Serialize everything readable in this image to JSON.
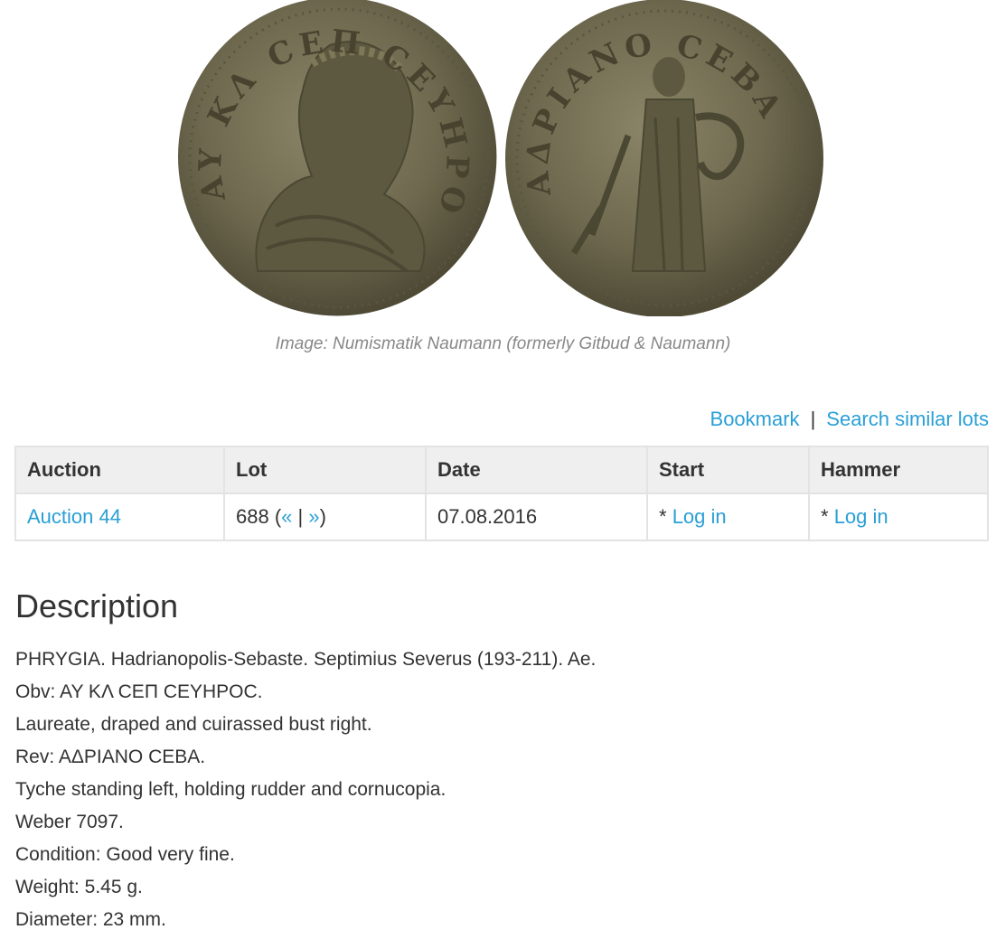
{
  "image": {
    "caption": "Image: Numismatik Naumann (formerly Gitbud & Naumann)",
    "obverse_legend": "AY KΛ CEΠ CEYHPOC",
    "reverse_legend": "AΔPIANO CEBA",
    "coin_color": "#6f6a4f"
  },
  "actions": {
    "bookmark_label": "Bookmark",
    "separator": "|",
    "search_similar_label": "Search similar lots"
  },
  "table": {
    "headers": [
      "Auction",
      "Lot",
      "Date",
      "Start",
      "Hammer"
    ],
    "row": {
      "auction": "Auction 44",
      "lot_number": "688",
      "lot_open": " (",
      "lot_prev": "«",
      "lot_sep": " | ",
      "lot_next": "»",
      "lot_close": ")",
      "date": "07.08.2016",
      "start_prefix": "* ",
      "start_link": "Log in",
      "hammer_prefix": "* ",
      "hammer_link": "Log in"
    }
  },
  "description": {
    "title": "Description",
    "lines": [
      "PHRYGIA. Hadrianopolis-Sebaste. Septimius Severus (193-211). Ae.",
      "Obv: AY KΛ CEΠ CEYHPOC.",
      "Laureate, draped and cuirassed bust right.",
      "Rev: AΔPIANO CEBA.",
      "Tyche standing left, holding rudder and cornucopia.",
      "Weber 7097.",
      "Condition: Good very fine.",
      "Weight: 5.45 g.",
      "Diameter: 23 mm."
    ]
  }
}
